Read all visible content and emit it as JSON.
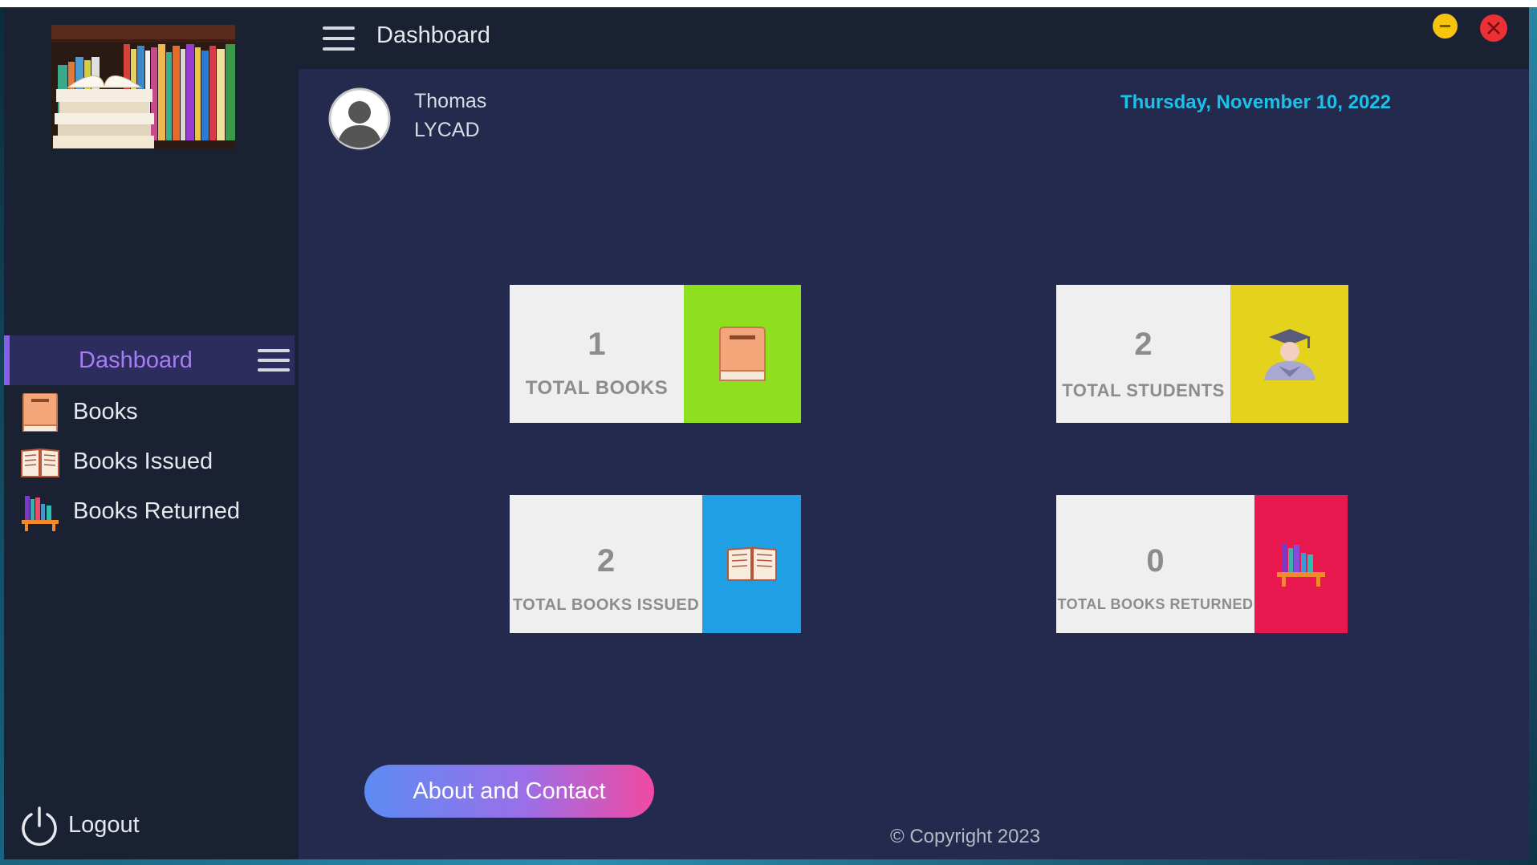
{
  "window": {
    "title": "Dashboard"
  },
  "user": {
    "name": "Thomas",
    "role": "LYCAD"
  },
  "date": "Thursday, November 10, 2022",
  "sidebar": {
    "items": [
      {
        "label": "Dashboard",
        "icon": "dashboard-menu-icon",
        "active": true
      },
      {
        "label": "Books",
        "icon": "book-icon"
      },
      {
        "label": "Books Issued",
        "icon": "open-book-icon"
      },
      {
        "label": "Books Returned",
        "icon": "bookshelf-icon"
      }
    ],
    "logout_label": "Logout"
  },
  "cards": [
    {
      "value": "1",
      "caption": "TOTAL BOOKS",
      "color": "#8ee01e",
      "icon": "book-icon"
    },
    {
      "value": "2",
      "caption": "TOTAL STUDENTS",
      "color": "#e5d21c",
      "icon": "student-icon"
    },
    {
      "value": "2",
      "caption": "TOTAL BOOKS ISSUED",
      "color": "#1f9fe4",
      "icon": "open-book-icon"
    },
    {
      "value": "0",
      "caption": "TOTAL BOOKS RETURNED",
      "color": "#e8194f",
      "icon": "bookshelf-icon"
    }
  ],
  "about_button": "About and Contact",
  "copyright": "© Copyright 2023",
  "colors": {
    "accent": "#8a5cf0",
    "date_text": "#1ec0e8",
    "minimize": "#f6c40f",
    "close": "#ec3136"
  }
}
